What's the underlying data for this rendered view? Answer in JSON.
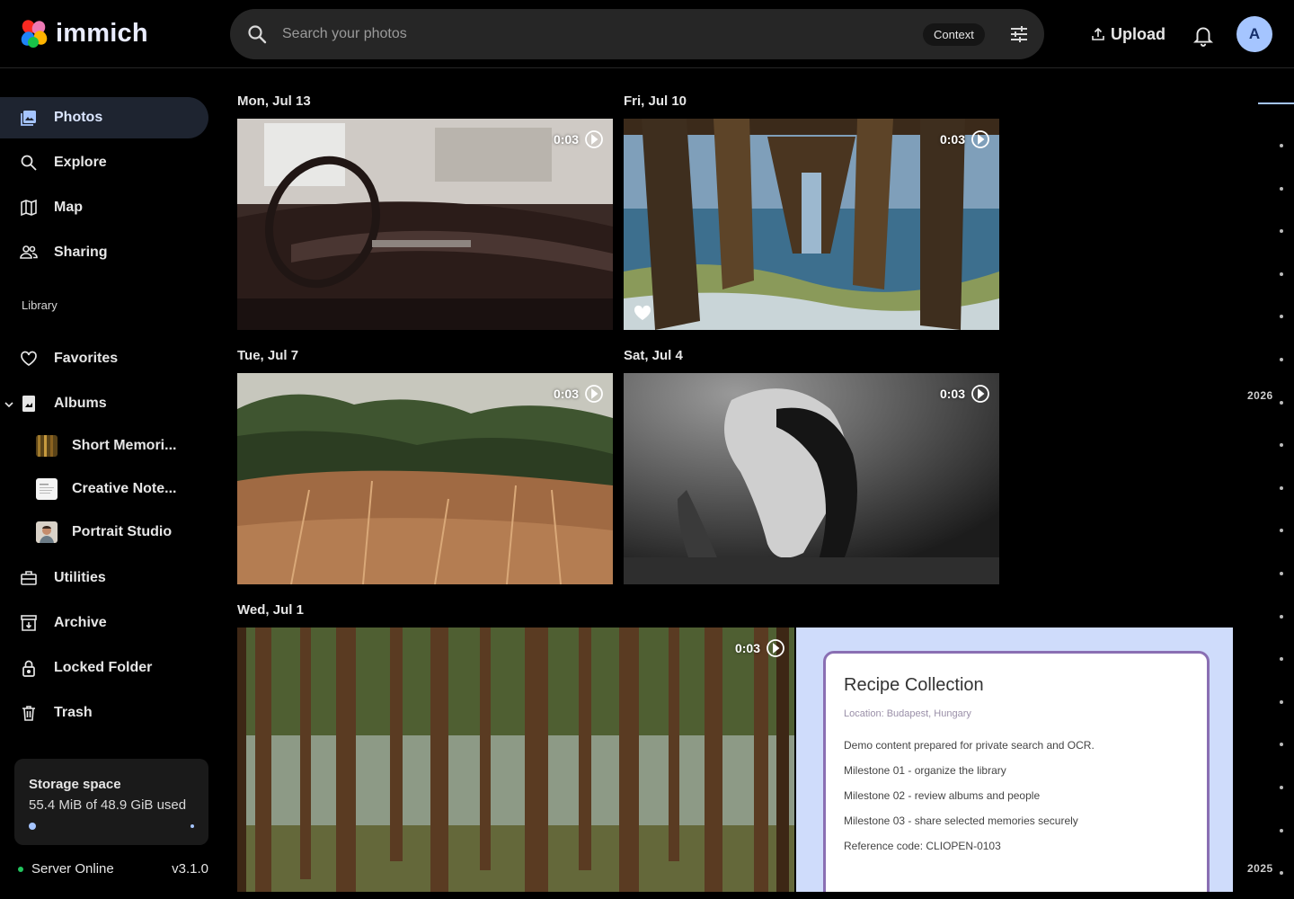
{
  "app": {
    "name": "immich"
  },
  "search": {
    "placeholder": "Search your photos",
    "context_label": "Context"
  },
  "header": {
    "upload_label": "Upload",
    "avatar_initial": "A"
  },
  "sidebar": {
    "items": [
      {
        "label": "Photos",
        "icon": "photos-icon",
        "active": true
      },
      {
        "label": "Explore",
        "icon": "search-icon"
      },
      {
        "label": "Map",
        "icon": "map-icon"
      },
      {
        "label": "Sharing",
        "icon": "people-icon"
      }
    ],
    "library_label": "Library",
    "library_items": [
      {
        "label": "Favorites",
        "icon": "heart-icon"
      },
      {
        "label": "Albums",
        "icon": "album-icon"
      }
    ],
    "albums": [
      {
        "label": "Short Memori..."
      },
      {
        "label": "Creative Note..."
      },
      {
        "label": "Portrait Studio"
      }
    ],
    "more_items": [
      {
        "label": "Utilities",
        "icon": "toolbox-icon"
      },
      {
        "label": "Archive",
        "icon": "archive-icon"
      },
      {
        "label": "Locked Folder",
        "icon": "lock-icon"
      },
      {
        "label": "Trash",
        "icon": "trash-icon"
      }
    ],
    "storage": {
      "title": "Storage space",
      "used_text": "55.4 MiB of 48.9 GiB used",
      "used_fraction": 0.0011
    },
    "server": {
      "status": "Server Online",
      "version": "v3.1.0"
    }
  },
  "timeline": {
    "groups": [
      {
        "date": "Mon, Jul 13",
        "assets": [
          {
            "type": "video",
            "duration": "0:03",
            "subject": "vintage car interior"
          }
        ]
      },
      {
        "date": "Fri, Jul 10",
        "assets": [
          {
            "type": "video",
            "duration": "0:03",
            "subject": "pier over ocean",
            "favorite": true
          }
        ]
      },
      {
        "date": "Tue, Jul 7",
        "assets": [
          {
            "type": "video",
            "duration": "0:03",
            "subject": "dry grass field"
          }
        ]
      },
      {
        "date": "Sat, Jul 4",
        "assets": [
          {
            "type": "video",
            "duration": "0:03",
            "subject": "underwater figure"
          }
        ]
      },
      {
        "date": "Wed, Jul 1",
        "assets": [
          {
            "type": "video",
            "duration": "0:03",
            "subject": "pine forest"
          },
          {
            "type": "image",
            "subject": "document screenshot"
          }
        ]
      }
    ],
    "document": {
      "title": "Recipe Collection",
      "location": "Location: Budapest, Hungary",
      "lines": [
        "Demo content prepared for private search and OCR.",
        "Milestone 01 - organize the library",
        "Milestone 02 - review albums and people",
        "Milestone 03 - share selected memories securely",
        "Reference code: CLIOPEN-0103"
      ]
    }
  },
  "scrubber": {
    "years": [
      "2026",
      "2025"
    ]
  },
  "colors": {
    "accent": "#a5c5ff",
    "active_nav_bg": "#1e2430",
    "online": "#22c55e"
  }
}
